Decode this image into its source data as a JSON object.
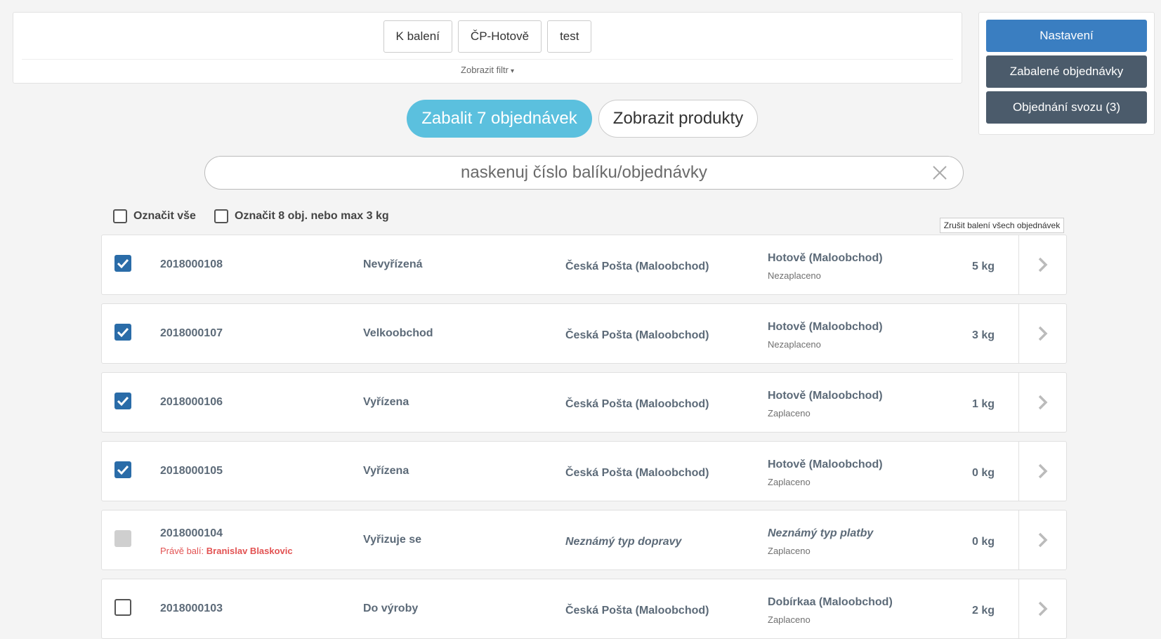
{
  "filter": {
    "tabs": [
      "K balení",
      "ČP-Hotově",
      "test"
    ],
    "toggle_label": "Zobrazit filtr"
  },
  "side": {
    "settings": "Nastavení",
    "packed_orders": "Zabalené objednávky",
    "pickup_order": "Objednání svozu (3)"
  },
  "actions": {
    "pack": "Zabalit 7 objednávek",
    "show_products": "Zobrazit produkty"
  },
  "scan": {
    "placeholder": "naskenuj číslo balíku/objednávky"
  },
  "select": {
    "all": "Označit vše",
    "limit": "Označit 8 obj. nebo max 3 kg"
  },
  "tooltip": "Zrušit balení všech objednávek",
  "colors": {
    "primary": "#3a7ec1",
    "dark": "#4b5b6b",
    "info": "#5bc0de",
    "checkbox": "#2a6ca8",
    "warning_text": "#e25252"
  },
  "orders": [
    {
      "number": "2018000108",
      "status": "Nevyřízená",
      "shipping": "Česká Pošta (Maloobchod)",
      "payment": "Hotově (Maloobchod)",
      "payment_state": "Nezaplaceno",
      "weight": "5 kg",
      "check": "checked"
    },
    {
      "number": "2018000107",
      "status": "Velkoobchod",
      "shipping": "Česká Pošta (Maloobchod)",
      "payment": "Hotově (Maloobchod)",
      "payment_state": "Nezaplaceno",
      "weight": "3 kg",
      "check": "checked"
    },
    {
      "number": "2018000106",
      "status": "Vyřízena",
      "shipping": "Česká Pošta (Maloobchod)",
      "payment": "Hotově (Maloobchod)",
      "payment_state": "Zaplaceno",
      "weight": "1 kg",
      "check": "checked"
    },
    {
      "number": "2018000105",
      "status": "Vyřízena",
      "shipping": "Česká Pošta (Maloobchod)",
      "payment": "Hotově (Maloobchod)",
      "payment_state": "Zaplaceno",
      "weight": "0 kg",
      "check": "checked"
    },
    {
      "number": "2018000104",
      "packer_label": "Právě balí:",
      "packer_name": "Branislav Blaskovic",
      "status": "Vyřizuje se",
      "shipping": "Neznámý typ dopravy",
      "payment": "Neznámý typ platby",
      "payment_state": "Zaplaceno",
      "weight": "0 kg",
      "check": "disabled"
    },
    {
      "number": "2018000103",
      "status": "Do výroby",
      "shipping": "Česká Pošta (Maloobchod)",
      "payment": "Dobírkaa (Maloobchod)",
      "payment_state": "Zaplaceno",
      "weight": "2 kg",
      "check": "unchecked"
    }
  ]
}
